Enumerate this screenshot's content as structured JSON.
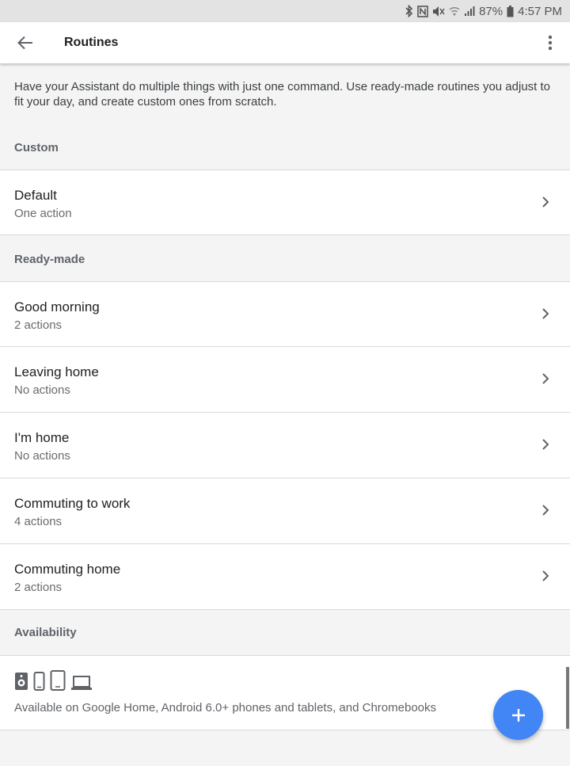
{
  "status_bar": {
    "battery": "87%",
    "time": "4:57 PM"
  },
  "app_bar": {
    "title": "Routines"
  },
  "intro": "Have your Assistant do multiple things with just one command. Use ready-made routines you adjust to fit your day, and create custom ones from scratch.",
  "custom": {
    "header": "Custom",
    "items": [
      {
        "label": "Default",
        "sub": "One action"
      }
    ]
  },
  "ready_made": {
    "header": "Ready-made",
    "items": [
      {
        "label": "Good morning",
        "sub": "2 actions"
      },
      {
        "label": "Leaving home",
        "sub": "No actions"
      },
      {
        "label": "I'm home",
        "sub": "No actions"
      },
      {
        "label": "Commuting to work",
        "sub": "4 actions"
      },
      {
        "label": "Commuting home",
        "sub": "2 actions"
      }
    ]
  },
  "availability": {
    "header": "Availability",
    "text": "Available on Google Home, Android 6.0+ phones and tablets, and Chromebooks",
    "device_icons": [
      "speaker-icon",
      "phone-icon",
      "tablet-icon",
      "laptop-icon"
    ]
  },
  "colors": {
    "fab": "#4285f4",
    "background": "#f4f4f4"
  }
}
